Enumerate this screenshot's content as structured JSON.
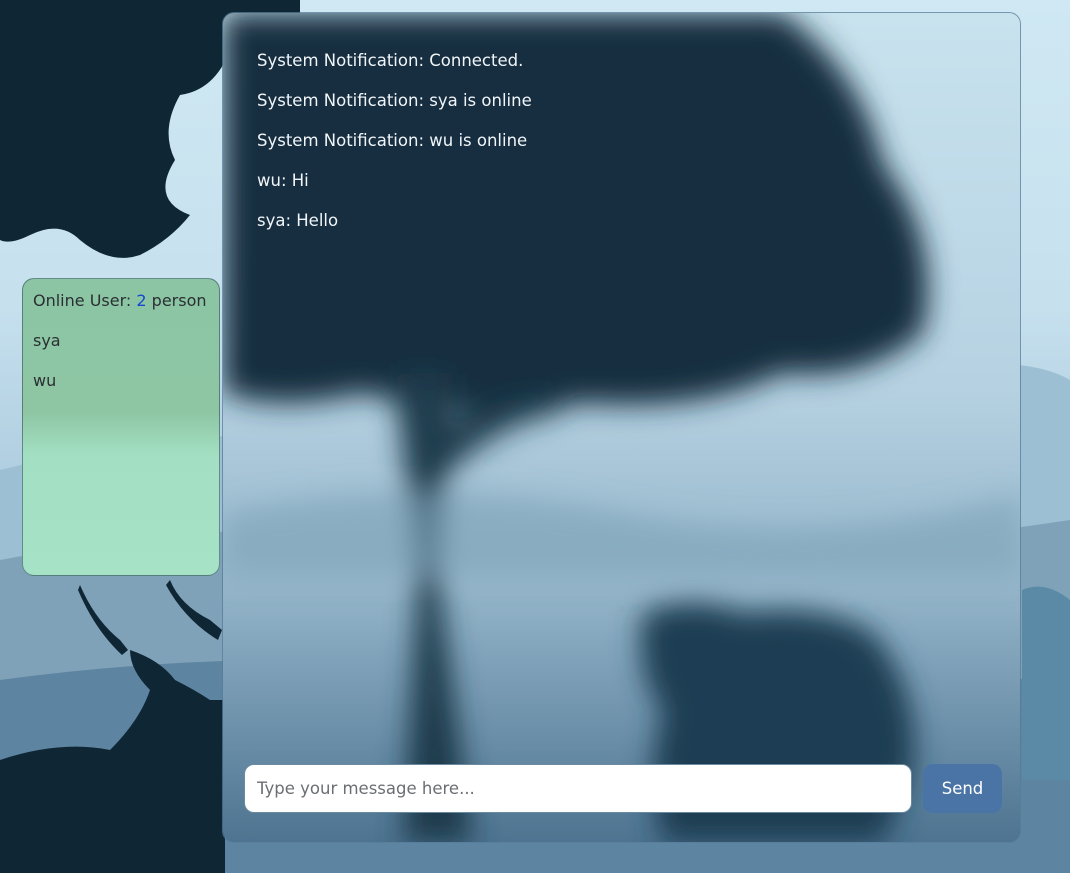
{
  "online_panel": {
    "label_prefix": "Online User:",
    "count": "2",
    "label_suffix": "person",
    "users": [
      "sya",
      "wu"
    ]
  },
  "chat": {
    "messages": [
      "System Notification: Connected.",
      "System Notification: sya is online",
      "System Notification: wu is online",
      "wu: Hi",
      "sya: Hello"
    ],
    "input_placeholder": "Type your message here...",
    "input_value": "",
    "send_label": "Send"
  },
  "colors": {
    "send_button": "#4a74a6",
    "online_count": "#1846d0",
    "panel_green": "#a6e2c6"
  }
}
